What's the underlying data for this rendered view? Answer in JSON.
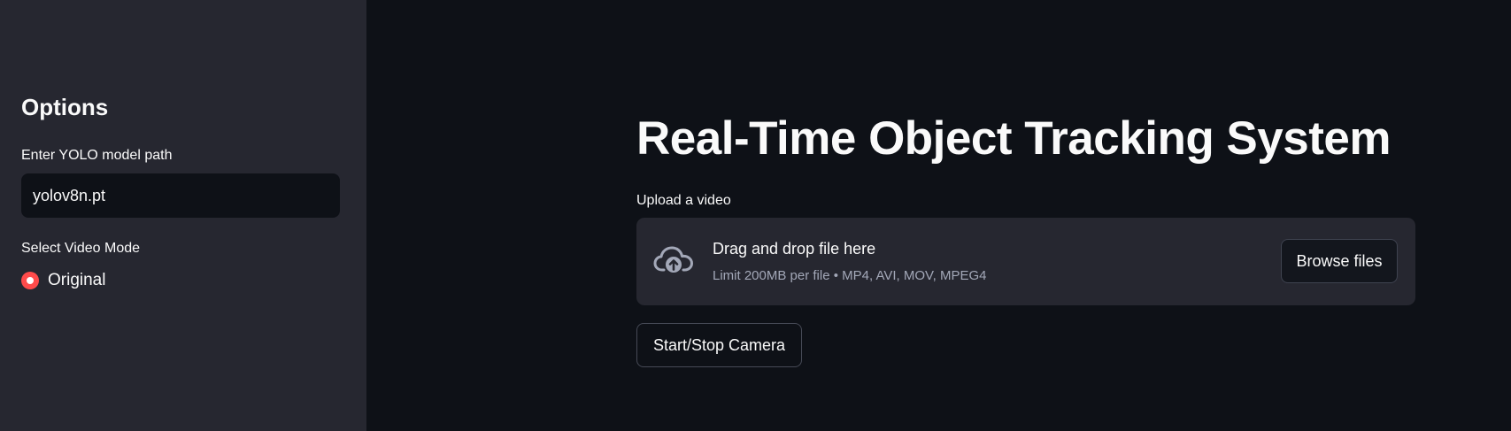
{
  "sidebar": {
    "title": "Options",
    "model_path_label": "Enter YOLO model path",
    "model_path_value": "yolov8n.pt",
    "video_mode_label": "Select Video Mode",
    "video_mode_options": [
      {
        "label": "Original",
        "selected": true
      }
    ]
  },
  "main": {
    "title": "Real-Time Object Tracking System",
    "upload": {
      "label": "Upload a video",
      "dropzone_title": "Drag and drop file here",
      "dropzone_limit": "Limit 200MB per file • MP4, AVI, MOV, MPEG4",
      "icon": "cloud-upload-icon",
      "browse_label": "Browse files"
    },
    "camera_button_label": "Start/Stop Camera"
  },
  "colors": {
    "background": "#0e1117",
    "sidebar_background": "#262730",
    "accent": "#ff4b4b",
    "text": "#fafafa",
    "muted_text": "#a3a8b8"
  }
}
